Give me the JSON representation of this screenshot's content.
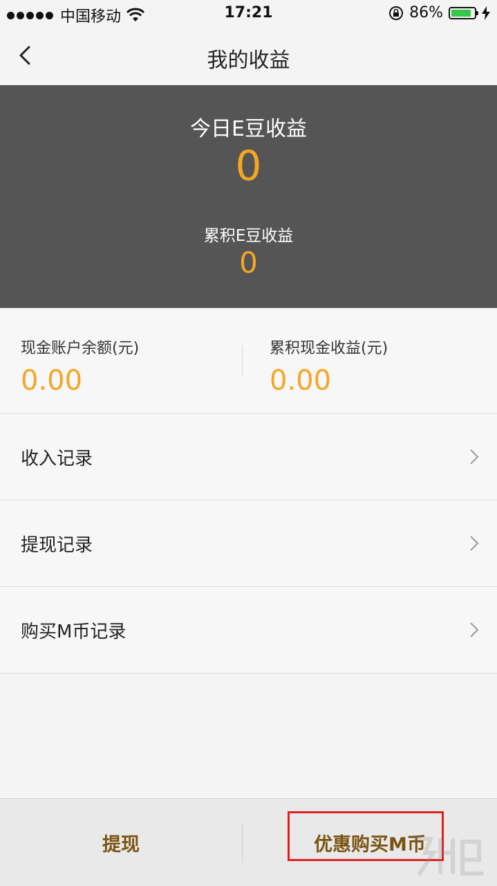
{
  "status_bar": {
    "carrier": "中国移动",
    "time": "17:21",
    "battery_percent": "86%",
    "battery_level": 0.86
  },
  "nav": {
    "title": "我的收益"
  },
  "summary": {
    "today_label": "今日E豆收益",
    "today_value": "0",
    "total_label": "累积E豆收益",
    "total_value": "0"
  },
  "cash": {
    "balance_label": "现金账户余额(元)",
    "balance_value": "0.00",
    "total_label": "累积现金收益(元)",
    "total_value": "0.00"
  },
  "list": {
    "items": [
      {
        "label": "收入记录"
      },
      {
        "label": "提现记录"
      },
      {
        "label": "购买M币记录"
      }
    ]
  },
  "bottom": {
    "withdraw_label": "提现",
    "buy_label": "优惠购买M币"
  },
  "colors": {
    "accent": "#f5a623",
    "panel": "#555555",
    "bottom_text": "#7a5412",
    "highlight": "#e02020",
    "battery": "#35c84a"
  },
  "icons": [
    "wifi-icon",
    "rotation-lock-icon",
    "battery-icon",
    "charging-bolt-icon",
    "back-arrow-icon",
    "chevron-right-icon"
  ]
}
